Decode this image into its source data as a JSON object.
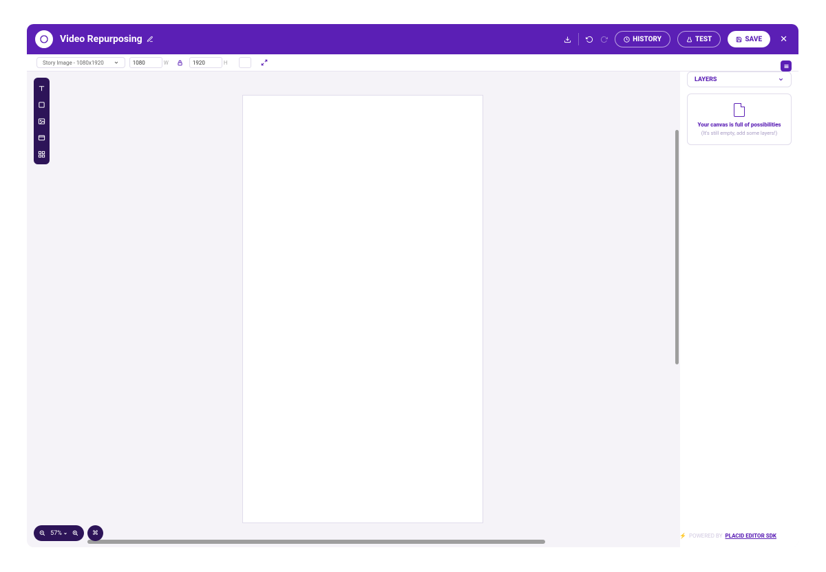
{
  "header": {
    "title": "Video Repurposing",
    "history_label": "HISTORY",
    "test_label": "TEST",
    "save_label": "SAVE"
  },
  "subbar": {
    "preset_label": "Story Image - 1080x1920",
    "width_value": "1080",
    "width_unit": "W",
    "height_value": "1920",
    "height_unit": "H"
  },
  "layers": {
    "header": "LAYERS",
    "empty_title": "Your canvas is full of possibilities",
    "empty_sub": "(It's still empty, add some layers!)"
  },
  "zoom": {
    "value": "57%"
  },
  "footer": {
    "powered": "POWERED BY",
    "brand": "PLACID EDITOR SDK"
  }
}
